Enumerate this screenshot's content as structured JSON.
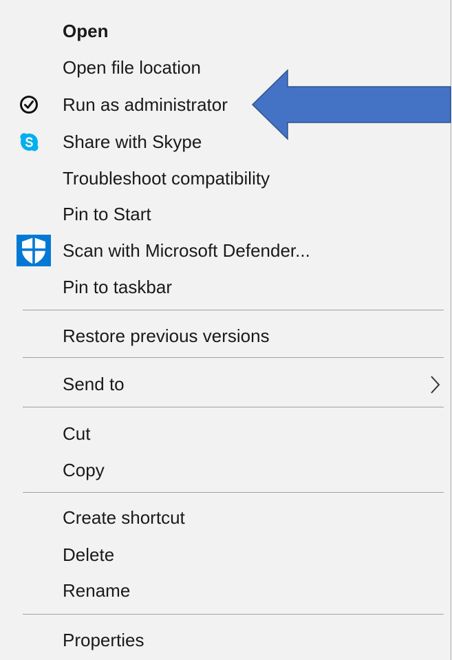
{
  "context_menu": {
    "items": [
      {
        "label": "Open"
      },
      {
        "label": "Open file location"
      },
      {
        "label": "Run as administrator",
        "icon": "check-circle-icon"
      },
      {
        "label": "Share with Skype",
        "icon": "skype-icon"
      },
      {
        "label": "Troubleshoot compatibility"
      },
      {
        "label": "Pin to Start"
      },
      {
        "label": "Scan with Microsoft Defender...",
        "icon": "defender-shield-icon"
      },
      {
        "label": "Pin to taskbar"
      },
      {
        "label": "Restore previous versions"
      },
      {
        "label": "Send to",
        "icon": "chevron-right-icon"
      },
      {
        "label": "Cut"
      },
      {
        "label": "Copy"
      },
      {
        "label": "Create shortcut"
      },
      {
        "label": "Delete"
      },
      {
        "label": "Rename"
      },
      {
        "label": "Properties"
      }
    ]
  },
  "annotation": {
    "icon": "blue-arrow-icon",
    "color": "#4472c4",
    "border_color": "#2f528f"
  },
  "colors": {
    "menu_background": "#f2f2f2",
    "text": "#1a1a1a",
    "separator": "#a0a0a0",
    "skype_blue": "#00aff0",
    "defender_blue": "#0078d4"
  }
}
